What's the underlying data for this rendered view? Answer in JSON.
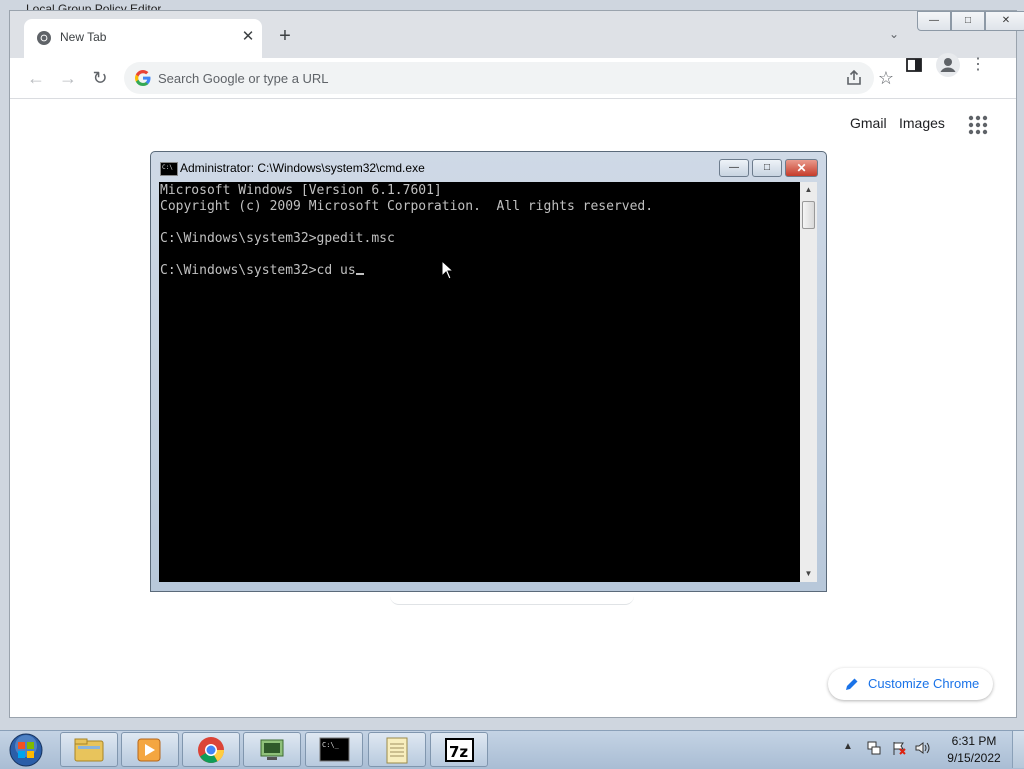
{
  "background_window": {
    "title": "Local Group Policy Editor"
  },
  "chrome": {
    "tab": {
      "title": "New Tab",
      "close_glyph": "✕"
    },
    "new_tab_glyph": "+",
    "tab_search_glyph": "⌄",
    "window_controls": {
      "minimize": "—",
      "maximize": "□",
      "close": "✕"
    },
    "omnibox": {
      "value": "",
      "placeholder": "Search Google or type a URL"
    },
    "ntp": {
      "gmail": "Gmail",
      "images": "Images",
      "customize_label": "Customize Chrome"
    },
    "colors": {
      "accent": "#1a73e8",
      "tabstrip": "#dee1e6"
    }
  },
  "cmd": {
    "title": "Administrator: C:\\Windows\\system32\\cmd.exe",
    "icon_text": "C:\\",
    "lines": [
      "Microsoft Windows [Version 6.1.7601]",
      "Copyright (c) 2009 Microsoft Corporation.  All rights reserved.",
      "",
      "C:\\Windows\\system32>gpedit.msc",
      "",
      "C:\\Windows\\system32>cd us"
    ],
    "controls": {
      "minimize": "—",
      "maximize": "□",
      "close": "✕"
    }
  },
  "taskbar": {
    "items": [
      "Windows Explorer",
      "Windows Media Player",
      "Google Chrome",
      "Remote Desktop",
      "Command Prompt",
      "Notepad",
      "7-Zip"
    ],
    "clock": {
      "time": "6:31 PM",
      "date": "9/15/2022"
    },
    "tray_arrow": "▲"
  }
}
